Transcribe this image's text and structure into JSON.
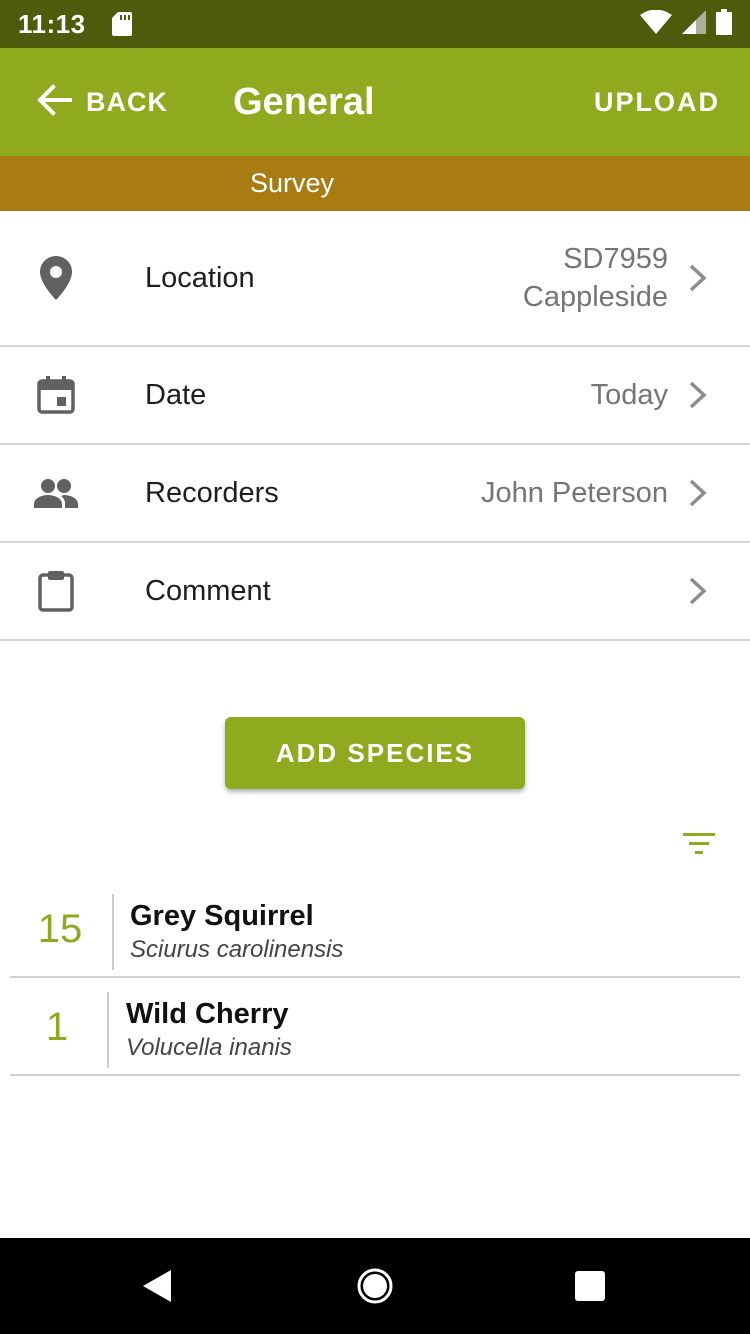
{
  "status_bar": {
    "time": "11:13"
  },
  "app_bar": {
    "back_label": "BACK",
    "title": "General",
    "upload_label": "UPLOAD",
    "color": "#8faa1e"
  },
  "sub_bar": {
    "label": "Survey",
    "color": "#a87c13"
  },
  "rows": [
    {
      "label": "Location",
      "value_line1": "SD7959",
      "value_line2": "Cappleside",
      "icon": "location-pin-icon"
    },
    {
      "label": "Date",
      "value": "Today",
      "icon": "calendar-icon"
    },
    {
      "label": "Recorders",
      "value": "John Peterson",
      "icon": "people-icon"
    },
    {
      "label": "Comment",
      "value": "",
      "icon": "clipboard-icon"
    }
  ],
  "add_species_label": "ADD SPECIES",
  "species": [
    {
      "count": "15",
      "name": "Grey Squirrel",
      "scientific": "Sciurus carolinensis"
    },
    {
      "count": "1",
      "name": "Wild Cherry",
      "scientific": "Volucella inanis"
    }
  ]
}
